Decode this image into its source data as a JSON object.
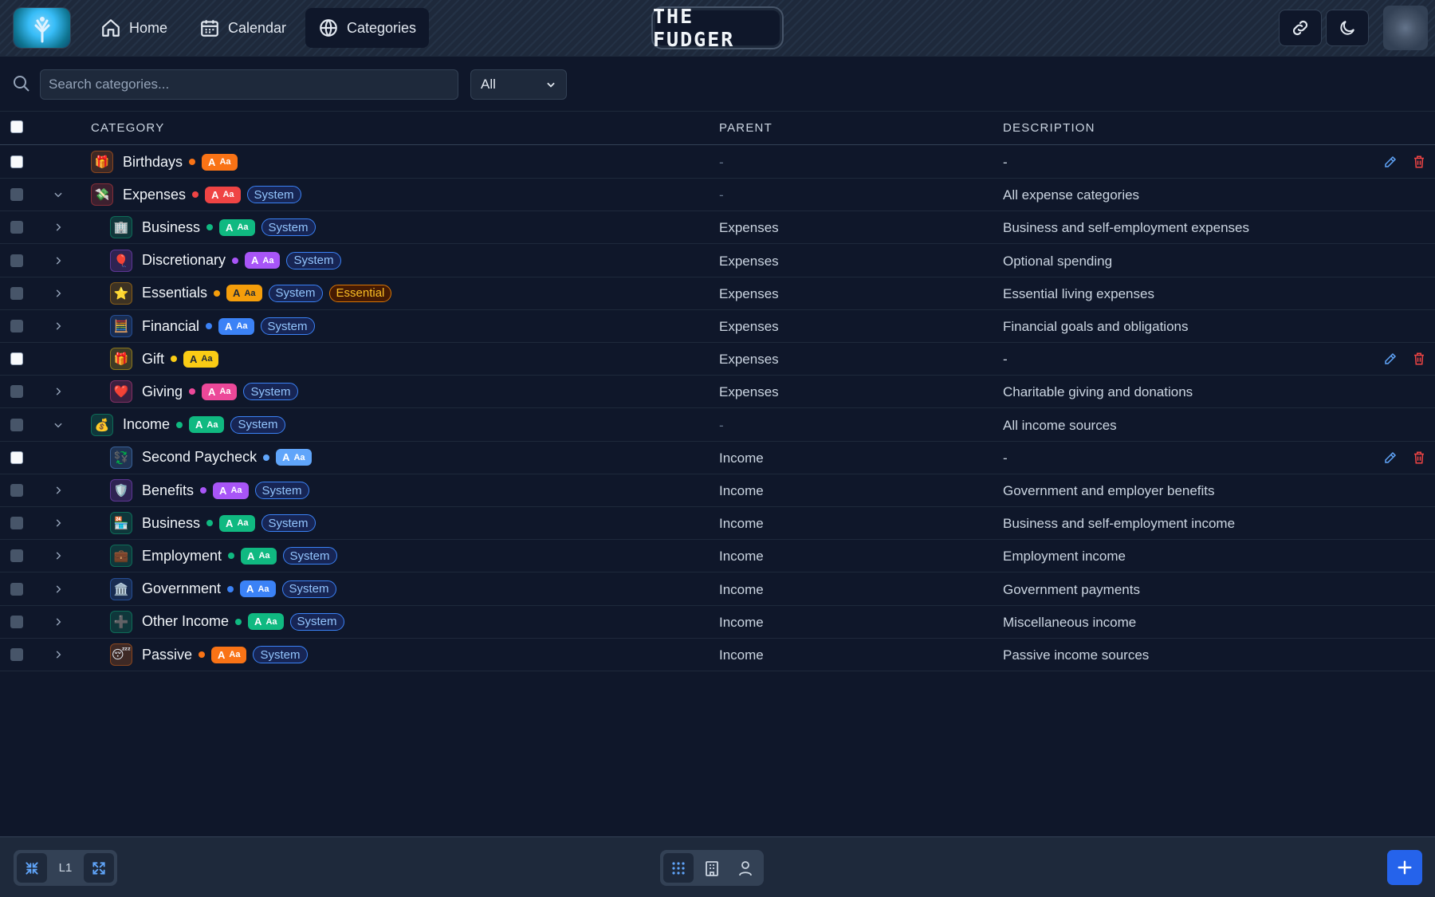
{
  "nav": {
    "items": [
      {
        "label": "Home",
        "icon": "home-icon"
      },
      {
        "label": "Calendar",
        "icon": "calendar-icon"
      },
      {
        "label": "Categories",
        "icon": "globe-icon"
      }
    ],
    "brand": "THE FUDGER"
  },
  "filters": {
    "search_placeholder": "Search categories...",
    "search_value": "",
    "select_value": "All"
  },
  "table": {
    "headers": {
      "category": "CATEGORY",
      "parent": "PARENT",
      "description": "DESCRIPTION"
    },
    "rows": [
      {
        "name": "Birthdays",
        "icon": "🎁",
        "parent": "-",
        "description": "-",
        "system": false,
        "essential": false,
        "expander": "none",
        "editable": true,
        "level": 0,
        "color": "#f97316"
      },
      {
        "name": "Expenses",
        "icon": "💸",
        "parent": "-",
        "description": "All expense categories",
        "system": true,
        "essential": false,
        "expander": "down",
        "editable": false,
        "level": 0,
        "color": "#ef4444"
      },
      {
        "name": "Business",
        "icon": "🏢",
        "parent": "Expenses",
        "description": "Business and self-employment expenses",
        "system": true,
        "essential": false,
        "expander": "right",
        "editable": false,
        "level": 1,
        "color": "#10b981"
      },
      {
        "name": "Discretionary",
        "icon": "🎈",
        "parent": "Expenses",
        "description": "Optional spending",
        "system": true,
        "essential": false,
        "expander": "right",
        "editable": false,
        "level": 1,
        "color": "#a855f7"
      },
      {
        "name": "Essentials",
        "icon": "⭐",
        "parent": "Expenses",
        "description": "Essential living expenses",
        "system": true,
        "essential": true,
        "expander": "right",
        "editable": false,
        "level": 1,
        "color": "#f59e0b"
      },
      {
        "name": "Financial",
        "icon": "🧮",
        "parent": "Expenses",
        "description": "Financial goals and obligations",
        "system": true,
        "essential": false,
        "expander": "right",
        "editable": false,
        "level": 1,
        "color": "#3b82f6"
      },
      {
        "name": "Gift",
        "icon": "🎁",
        "parent": "Expenses",
        "description": "-",
        "system": false,
        "essential": false,
        "expander": "none",
        "editable": true,
        "level": 1,
        "color": "#facc15"
      },
      {
        "name": "Giving",
        "icon": "❤️",
        "parent": "Expenses",
        "description": "Charitable giving and donations",
        "system": true,
        "essential": false,
        "expander": "right",
        "editable": false,
        "level": 1,
        "color": "#ec4899"
      },
      {
        "name": "Income",
        "icon": "💰",
        "parent": "-",
        "description": "All income sources",
        "system": true,
        "essential": false,
        "expander": "down",
        "editable": false,
        "level": 0,
        "color": "#10b981"
      },
      {
        "name": "Second Paycheck",
        "icon": "💱",
        "parent": "Income",
        "description": "-",
        "system": false,
        "essential": false,
        "expander": "none",
        "editable": true,
        "level": 1,
        "color": "#60a5fa"
      },
      {
        "name": "Benefits",
        "icon": "🛡️",
        "parent": "Income",
        "description": "Government and employer benefits",
        "system": true,
        "essential": false,
        "expander": "right",
        "editable": false,
        "level": 1,
        "color": "#a855f7"
      },
      {
        "name": "Business",
        "icon": "🏪",
        "parent": "Income",
        "description": "Business and self-employment income",
        "system": true,
        "essential": false,
        "expander": "right",
        "editable": false,
        "level": 1,
        "color": "#10b981"
      },
      {
        "name": "Employment",
        "icon": "💼",
        "parent": "Income",
        "description": "Employment income",
        "system": true,
        "essential": false,
        "expander": "right",
        "editable": false,
        "level": 1,
        "color": "#10b981"
      },
      {
        "name": "Government",
        "icon": "🏛️",
        "parent": "Income",
        "description": "Government payments",
        "system": true,
        "essential": false,
        "expander": "right",
        "editable": false,
        "level": 1,
        "color": "#3b82f6"
      },
      {
        "name": "Other Income",
        "icon": "➕",
        "parent": "Income",
        "description": "Miscellaneous income",
        "system": true,
        "essential": false,
        "expander": "right",
        "editable": false,
        "level": 1,
        "color": "#10b981"
      },
      {
        "name": "Passive",
        "icon": "😴",
        "parent": "Income",
        "description": "Passive income sources",
        "system": true,
        "essential": false,
        "expander": "right",
        "editable": false,
        "level": 1,
        "color": "#f97316"
      }
    ],
    "tags": {
      "system": "System",
      "essential": "Essential",
      "style_glyph": "A",
      "style_sample": "Aa"
    }
  },
  "bottombar": {
    "level_label": "L1",
    "collapse_icon": "collapse-icon",
    "expand_icon": "expand-icon",
    "view_icons": [
      "grid-view-icon",
      "building-view-icon",
      "user-view-icon"
    ],
    "add_icon": "plus-icon"
  },
  "colors": {
    "background": "#0f172a",
    "accent": "#2563eb",
    "edit": "#60a5fa",
    "delete": "#ef4444"
  }
}
